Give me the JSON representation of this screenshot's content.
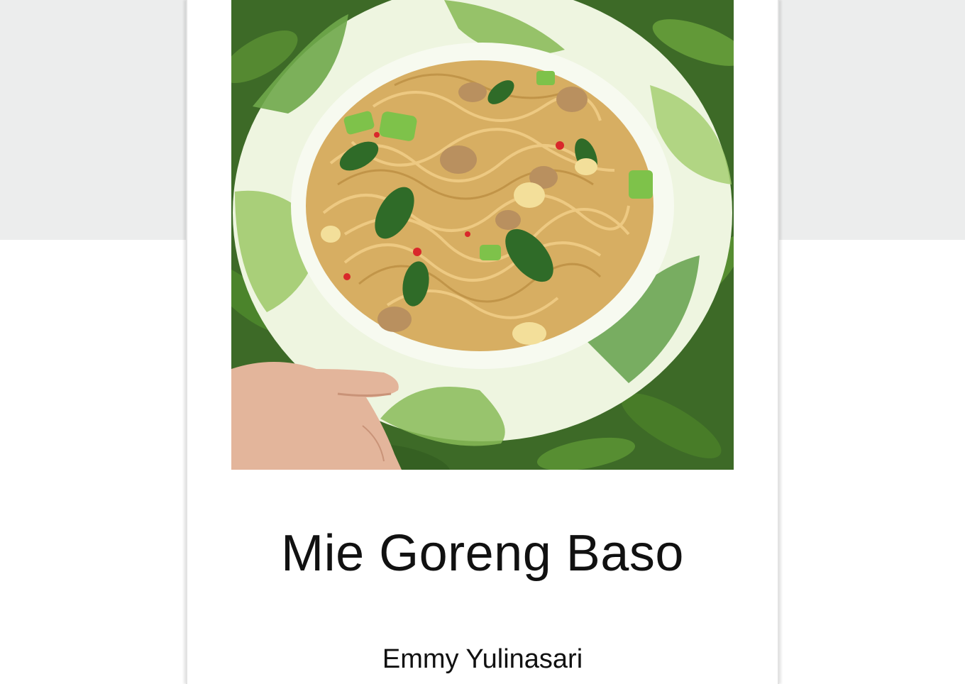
{
  "recipe": {
    "title": "Mie Goreng Baso",
    "author": "Emmy Yulinasari"
  },
  "photo": {
    "subject": "plate of fried noodles with meatballs held by a hand over green foliage"
  },
  "colors": {
    "background_band": "#eceded",
    "card": "#ffffff",
    "text": "#111111",
    "plate": "#e8f2d6",
    "leaf_accent": "#7fb24a",
    "noodles": "#d9b36a"
  }
}
